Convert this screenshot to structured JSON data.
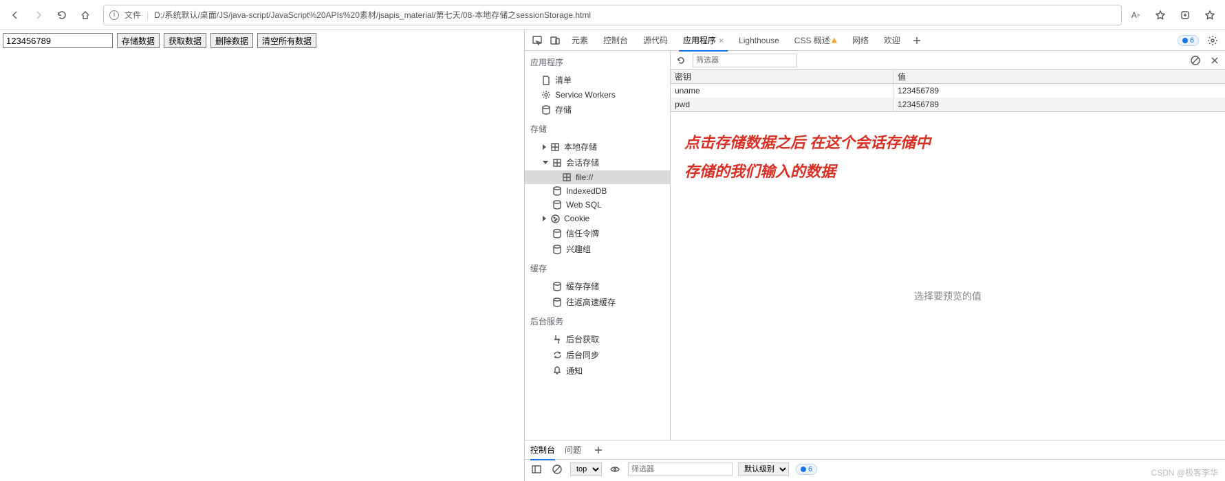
{
  "addrbar": {
    "label": "文件",
    "url": "D:/系统默认/桌面/JS/java-script/JavaScript%20APIs%20素材/jsapis_material/第七天/08-本地存储之sessionStorage.html"
  },
  "page": {
    "input_value": "123456789",
    "btn_store": "存储数据",
    "btn_get": "获取数据",
    "btn_delete": "删除数据",
    "btn_clear": "清空所有数据"
  },
  "devtools": {
    "tabs": {
      "elements": "元素",
      "console": "控制台",
      "sources": "源代码",
      "application": "应用程序",
      "lighthouse": "Lighthouse",
      "css": "CSS 概述",
      "network": "网络",
      "welcome": "欢迎"
    },
    "badge_count": "6",
    "sidebar": {
      "app_title": "应用程序",
      "app_items": {
        "manifest": "清单",
        "sw": "Service Workers",
        "storage": "存储"
      },
      "storage_title": "存储",
      "local": "本地存储",
      "session": "会话存储",
      "file": "file://",
      "indexeddb": "IndexedDB",
      "websql": "Web SQL",
      "cookie": "Cookie",
      "trust": "信任令牌",
      "interest": "兴趣组",
      "cache_title": "缓存",
      "cache_storage": "缓存存储",
      "back_cache": "往返高速缓存",
      "bgservice_title": "后台服务",
      "bg_fetch": "后台获取",
      "bg_sync": "后台同步",
      "notify": "通知"
    },
    "storage": {
      "filter_placeholder": "筛选器",
      "col_key": "密钥",
      "col_value": "值",
      "rows": [
        {
          "k": "uname",
          "v": "123456789"
        },
        {
          "k": "pwd",
          "v": "123456789"
        }
      ],
      "annotation_l1": "点击存储数据之后 在这个会话存储中",
      "annotation_l2": "存储的我们输入的数据",
      "preview": "选择要预览的值"
    },
    "drawer": {
      "tab_console": "控制台",
      "tab_issues": "问题",
      "top": "top",
      "filter_placeholder": "筛选器",
      "level": "默认级别",
      "badge": "6"
    }
  },
  "watermark": "CSDN @极客李华"
}
